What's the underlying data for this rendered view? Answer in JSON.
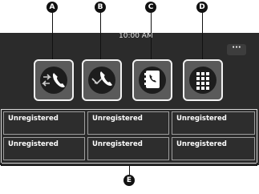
{
  "status_bar": {
    "time": "10:00 AM"
  },
  "menu": {
    "more_label": "···",
    "icon": "more-icon"
  },
  "quick_buttons": [
    {
      "callout": "A",
      "icon": "call-transfer-icon"
    },
    {
      "callout": "B",
      "icon": "recent-calls-icon"
    },
    {
      "callout": "C",
      "icon": "contacts-icon"
    },
    {
      "callout": "D",
      "icon": "keypad-icon"
    }
  ],
  "favorites": {
    "callout": "E",
    "slots": [
      "Unregistered",
      "Unregistered",
      "Unregistered",
      "Unregistered",
      "Unregistered",
      "Unregistered"
    ]
  },
  "colors": {
    "screen": "#2b2b2b",
    "tile": "#5a5a5a",
    "callout": "#111111"
  }
}
